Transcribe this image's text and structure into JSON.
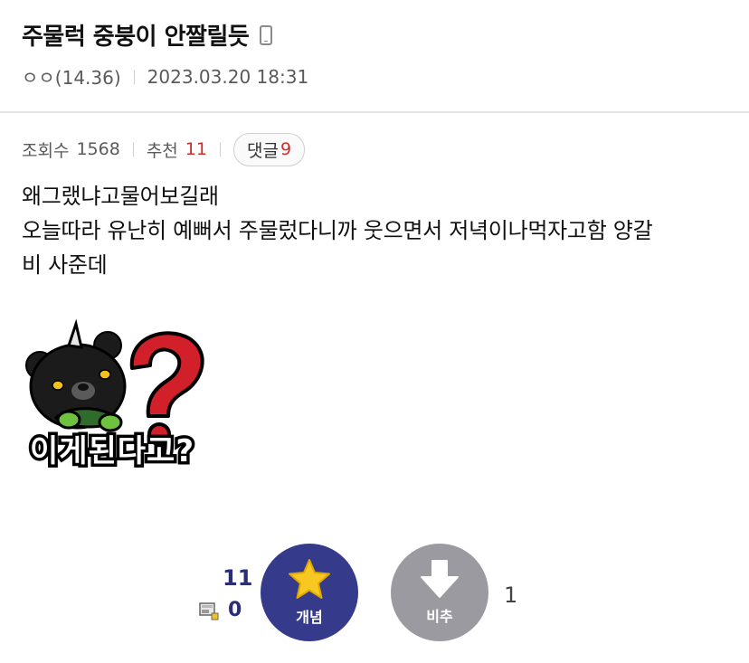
{
  "post": {
    "title": "주물럭 중붕이 안짤릴듯",
    "author": "ㅇㅇ(14.36)",
    "date": "2023.03.20 18:31",
    "views_label": "조회수",
    "views": "1568",
    "recommend_label": "추천",
    "recommend": "11",
    "comment_label": "댓글",
    "comment_count": "9",
    "body_lines": [
      "왜그랬냐고물어보길래",
      "오늘따라 유난히 예뻐서 주물렀다니까 웃으면서 저녁이나먹자고함 양갈",
      "비 사준데"
    ]
  },
  "sticker": {
    "caption": "이게된다고?"
  },
  "vote": {
    "up_count": "11",
    "fixed_count": "0",
    "up_label": "개념",
    "down_label": "비추",
    "down_count": "1"
  },
  "colors": {
    "up_button": "#353a8a",
    "down_button": "#9a9aa0",
    "accent_red": "#c8312b",
    "star": "#f7c821"
  },
  "icons": [
    "mobile-phone-icon",
    "star-icon",
    "down-arrow-icon",
    "fixed-user-icon"
  ]
}
